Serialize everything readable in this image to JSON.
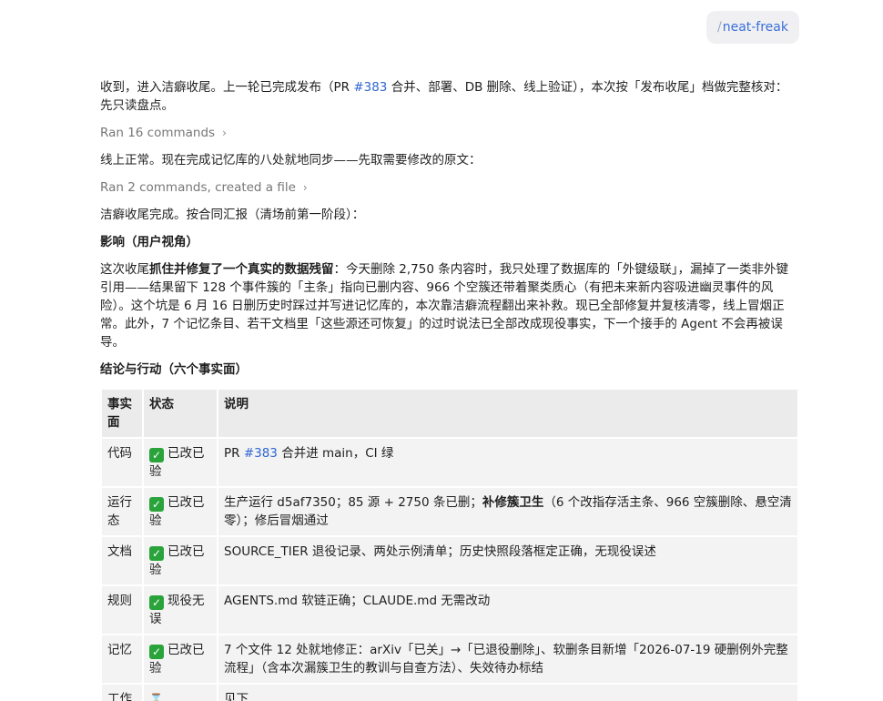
{
  "command_chip": {
    "slash": "/",
    "name": "neat-freak"
  },
  "messages": {
    "intro_a": "收到，进入洁癖收尾。上一轮已完成发布（PR ",
    "intro_pr": "#383",
    "intro_b": " 合并、部署、DB 删除、线上验证），本次按「发布收尾」档做完整核对：先只读盘点。",
    "run1": "Ran 16 commands",
    "line2": "线上正常。现在完成记忆库的八处就地同步——先取需要修改的原文：",
    "run2": "Ran 2 commands, created a file",
    "line3": "洁癖收尾完成。按合同汇报（清场前第一阶段）：",
    "impact_heading": "影响（用户视角）",
    "impact_a": "这次收尾",
    "impact_bold": "抓住并修复了一个真实的数据残留",
    "impact_b": "：今天删除 2,750 条内容时，我只处理了数据库的「外键级联」，漏掉了一类非外键引用——结果留下 128 个事件簇的「主条」指向已删内容、966 个空簇还带着聚类质心（有把未来新内容吸进幽灵事件的风险）。这个坑是 6 月 16 日删历史时踩过并写进记忆库的，本次靠洁癖流程翻出来补救。现已全部修复并复核清零，线上冒烟正常。此外，7 个记忆条目、若干文档里「这些源还可恢复」的过时说法已全部改成现役事实，下一个接手的 Agent 不会再被误导。",
    "conclusion_heading": "结论与行动（六个事实面）"
  },
  "table": {
    "headers": [
      "事实面",
      "状态",
      "说明"
    ],
    "rows": [
      {
        "facet": "代码",
        "icon": "check-icon",
        "status": "已改已验",
        "desc_a": "PR ",
        "desc_link": "#383",
        "desc_bold": "",
        "desc_b": " 合并进 main，CI 绿"
      },
      {
        "facet": "运行态",
        "icon": "check-icon",
        "status": "已改已验",
        "desc_a": "生产运行 d5af7350；85 源 + 2750 条已删；",
        "desc_link": "",
        "desc_bold": "补修簇卫生",
        "desc_b": "（6 个改指存活主条、966 空簇删除、悬空清零）；修后冒烟通过"
      },
      {
        "facet": "文档",
        "icon": "check-icon",
        "status": "已改已验",
        "desc_a": "SOURCE_TIER 退役记录、两处示例清单；历史快照段落框定正确，无现役误述",
        "desc_link": "",
        "desc_bold": "",
        "desc_b": ""
      },
      {
        "facet": "规则",
        "icon": "check-icon",
        "status": "现役无误",
        "desc_a": "AGENTS.md 软链正确；CLAUDE.md 无需改动",
        "desc_link": "",
        "desc_bold": "",
        "desc_b": ""
      },
      {
        "facet": "记忆",
        "icon": "check-icon",
        "status": "已改已验",
        "desc_a": "7 个文件 12 处就地修正：arXiv「已关」→「已退役删除」、软删条目新增「2026-07-19 硬删例外完整流程」（含本次漏簇卫生的教训与自查方法）、失效待办标结",
        "desc_link": "",
        "desc_bold": "",
        "desc_b": ""
      },
      {
        "facet": "工作",
        "icon": "hourglass-icon",
        "status": "",
        "desc_a": "见下",
        "desc_link": "",
        "desc_bold": "",
        "desc_b": ""
      }
    ]
  },
  "colors": {
    "link": "#2f66d0",
    "check": "#2aa33b",
    "chip_bg": "#f0f0f3"
  }
}
